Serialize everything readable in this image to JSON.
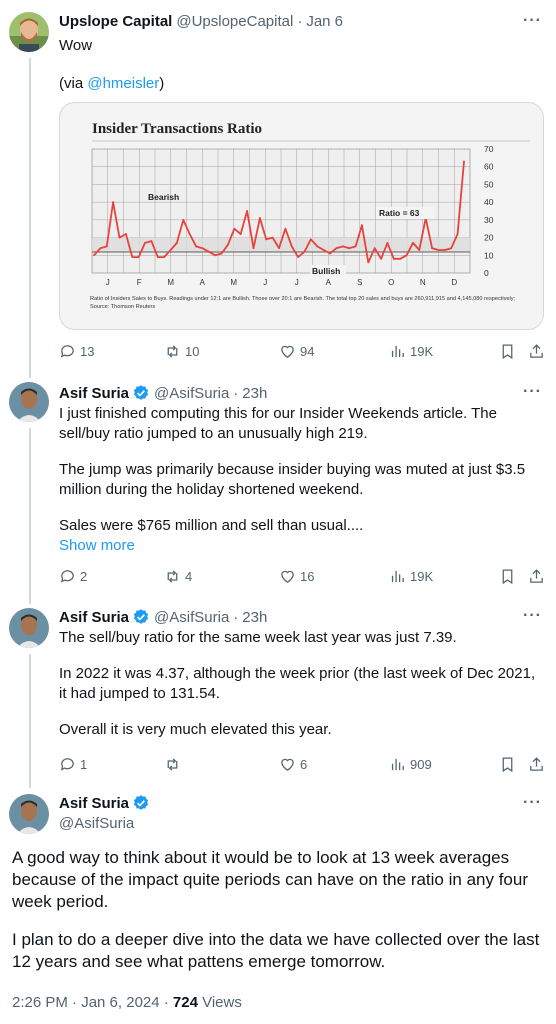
{
  "tweet1": {
    "name": "Upslope Capital",
    "handle": "@UpslopeCapital",
    "time": "Jan 6",
    "text1": "Wow",
    "via_prefix": "(via ",
    "via_link": "@hmeisler",
    "via_suffix": ")",
    "stats": {
      "replies": "13",
      "retweets": "10",
      "likes": "94",
      "views": "19K"
    }
  },
  "tweet2": {
    "name": "Asif Suria",
    "handle": "@AsifSuria",
    "time": "23h",
    "para1": "I just finished computing this for our Insider Weekends article. The sell/buy ratio jumped to an unusually high 219.",
    "para2": "The jump was primarily because insider buying was muted at just $3.5 million during the holiday shortened weekend.",
    "para3": "Sales were $765 million and sell than usual....",
    "show_more": "Show more",
    "stats": {
      "replies": "2",
      "retweets": "4",
      "likes": "16",
      "views": "19K"
    }
  },
  "tweet3": {
    "name": "Asif Suria",
    "handle": "@AsifSuria",
    "time": "23h",
    "para1": "The sell/buy ratio for the same week last year was just 7.39.",
    "para2": "In 2022 it was 4.37, although the week prior (the last week of Dec 2021, it had jumped to 131.54.",
    "para3": "Overall it is very much elevated this year.",
    "stats": {
      "replies": "1",
      "retweets": "",
      "likes": "6",
      "views": "909"
    }
  },
  "main": {
    "name": "Asif Suria",
    "handle": "@AsifSuria",
    "para1": "A good way to think about it would be to look at 13 week averages because of the impact quite periods can have on the ratio in any four week period.",
    "para2": "I plan to do a deeper dive into the data we have collected over the last 12 years and see what pattens emerge tomorrow.",
    "timestamp": "2:26 PM · Jan 6, 2024 · ",
    "views_count": "724",
    "views_label": " Views"
  },
  "more_glyph": "···",
  "chart_data": {
    "type": "line",
    "title": "Insider Transactions Ratio",
    "months": [
      "J",
      "F",
      "M",
      "A",
      "M",
      "J",
      "J",
      "A",
      "S",
      "O",
      "N",
      "D"
    ],
    "y_ticks": [
      "70",
      "60",
      "50",
      "40",
      "30",
      "20",
      "10",
      "0"
    ],
    "ylim": [
      0,
      70
    ],
    "label_bearish": "Bearish",
    "label_bullish": "Bullish",
    "label_ratio": "Ratio = 63",
    "caption": "Ratio of Insiders Sales to Buys. Readings under 12:1 are Bullish. Those over 20:1 are Bearish. The total top 20 sales and buys are 260,911,915 and 4,145,080 respectively; Source: Thomson Reuters",
    "line_color": "#e8423c",
    "values": [
      10,
      14,
      15,
      40,
      20,
      22,
      9,
      9,
      17,
      18,
      9,
      9,
      13,
      17,
      30,
      22,
      15,
      14,
      12,
      10,
      11,
      16,
      25,
      22,
      35,
      14,
      31,
      19,
      20,
      14,
      25,
      15,
      9,
      12,
      19,
      15,
      13,
      11,
      14,
      15,
      14,
      15,
      27,
      6,
      14,
      8,
      17,
      8,
      8,
      10,
      17,
      13,
      31,
      14,
      13,
      13,
      14,
      22,
      63
    ]
  },
  "colors": {
    "accent": "#1d9bf0",
    "muted": "#536471"
  }
}
